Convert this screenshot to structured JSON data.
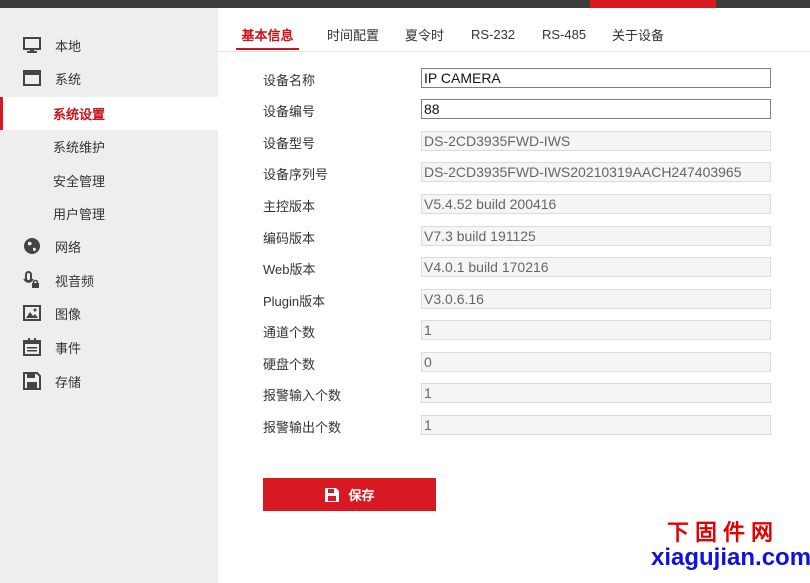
{
  "tabs": [
    {
      "label": "基本信息",
      "active": true
    },
    {
      "label": "时间配置",
      "active": false
    },
    {
      "label": "夏令时",
      "active": false
    },
    {
      "label": "RS-232",
      "active": false
    },
    {
      "label": "RS-485",
      "active": false
    },
    {
      "label": "关于设备",
      "active": false
    }
  ],
  "sidebar": {
    "items": [
      {
        "label": "本地",
        "icon": "monitor-icon"
      },
      {
        "label": "系统",
        "icon": "window-icon"
      },
      {
        "label": "系统设置",
        "active": true
      },
      {
        "label": "系统维护"
      },
      {
        "label": "安全管理"
      },
      {
        "label": "用户管理"
      },
      {
        "label": "网络",
        "icon": "globe-icon"
      },
      {
        "label": "视音频",
        "icon": "microphone-camera-icon"
      },
      {
        "label": "图像",
        "icon": "image-icon"
      },
      {
        "label": "事件",
        "icon": "calendar-icon"
      },
      {
        "label": "存储",
        "icon": "floppy-disk-icon"
      }
    ]
  },
  "form": {
    "rows": [
      {
        "label": "设备名称",
        "value": "IP CAMERA",
        "editable": true
      },
      {
        "label": "设备编号",
        "value": "88",
        "editable": true
      },
      {
        "label": "设备型号",
        "value": "DS-2CD3935FWD-IWS",
        "editable": false
      },
      {
        "label": "设备序列号",
        "value": "DS-2CD3935FWD-IWS20210319AACH247403965",
        "editable": false
      },
      {
        "label": "主控版本",
        "value": "V5.4.52 build 200416",
        "editable": false
      },
      {
        "label": "编码版本",
        "value": "V7.3 build 191125",
        "editable": false
      },
      {
        "label": "Web版本",
        "value": "V4.0.1 build 170216",
        "editable": false
      },
      {
        "label": "Plugin版本",
        "value": "V3.0.6.16",
        "editable": false
      },
      {
        "label": "通道个数",
        "value": "1",
        "editable": false
      },
      {
        "label": "硬盘个数",
        "value": "0",
        "editable": false
      },
      {
        "label": "报警输入个数",
        "value": "1",
        "editable": false
      },
      {
        "label": "报警输出个数",
        "value": "1",
        "editable": false
      }
    ],
    "save_label": "保存"
  },
  "watermark": {
    "cn": "下固件网",
    "en": "xiagujian.com"
  },
  "colors": {
    "accent": "#d71a21",
    "topbar": "#3c3c3c",
    "sidebar_bg": "#eeeeee"
  }
}
